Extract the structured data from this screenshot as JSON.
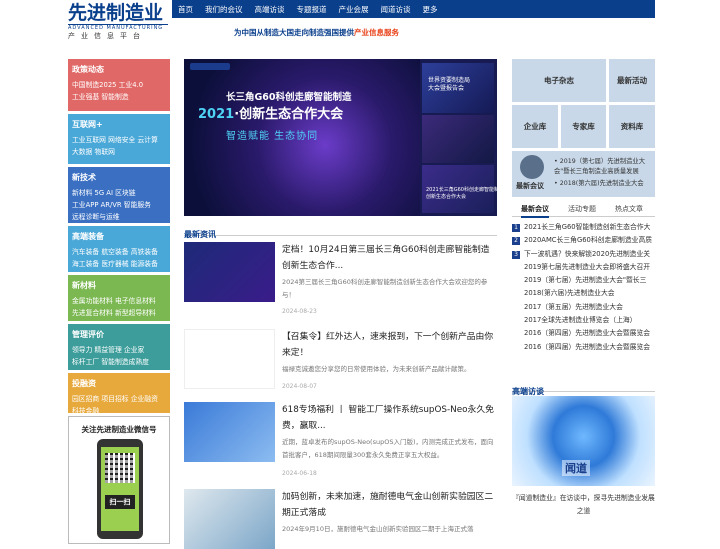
{
  "logo": {
    "name": "先进制造业",
    "en": "ADVANCED MANUFACTURING",
    "sub": "产业信息平台"
  },
  "nav": [
    "首页",
    "我们的会议",
    "高端访谈",
    "专题报道",
    "产业会展",
    "闻道访谈",
    "更多"
  ],
  "slogan": {
    "text": "为中国从制造大国走向制造强国提供",
    "hl": "产业信息服务"
  },
  "categories": [
    {
      "title": "政策动态",
      "lines": [
        "中国制造2025  工业4.0",
        "工业强基  智能制造"
      ]
    },
    {
      "title": "互联网+",
      "lines": [
        "工业互联网  网络安全  云计算",
        "大数据  物联网"
      ]
    },
    {
      "title": "新技术",
      "lines": [
        "新材料  5G  AI  区块链",
        "工业APP  AR/VR  智能服务",
        "远程诊断与运维"
      ]
    },
    {
      "title": "高端装备",
      "lines": [
        "汽车装备  航空装备  高铁装备",
        "海工装备  医疗器械  能源装备"
      ]
    },
    {
      "title": "新材料",
      "lines": [
        "金属功能材料  电子信息材料",
        "先进复合材料  新型超导材料"
      ]
    },
    {
      "title": "管理评价",
      "lines": [
        "领导力  精益管理  企业家",
        "标杆工厂  智能制造成熟度"
      ]
    },
    {
      "title": "投融资",
      "lines": [
        "园区招商  项目招标  企业融资",
        "科技金融"
      ]
    }
  ],
  "wechat": {
    "title": "关注先进制造业微信号",
    "scan": "扫一扫"
  },
  "banner": {
    "line1": "长三角G60科创走廊智能制造",
    "year": "2021",
    "line2": "·创新生态合作大会",
    "line3": "智造赋能  生态协同",
    "side1": "世界资要制造局\n大会暨报告会",
    "side3": "2021长三角G60科创走廊智能制造\n创新生态合作大会"
  },
  "latest_title": "最新资讯",
  "news": [
    {
      "title": "定档！10月24日第三届长三角G60科创走廊智能制造创新生态合作...",
      "desc": "2024第三届长三角G60科创走廊智能制造创新生态合作大会欢迎您的参与！",
      "date": "2024-08-23"
    },
    {
      "title": "【召集令】红外达人，速来报到，下一个创新产品由你来定！",
      "desc": "福禄克诚邀您分享您的日常使用体验，为未来创新产品献计献策。",
      "date": "2024-08-07"
    },
    {
      "title": "618专场福利 丨 智能工厂操作系统supOS-Neo永久免费，赢取...",
      "desc": "近期，蓝卓发布的supOS-Neo(supOS入门版)，内测完成正式发布，面向首批客户，618期间限量300套永久免费正享五大权益。",
      "date": "2024-06-18"
    },
    {
      "title": "加码创新，未来加速，施耐德电气金山创新实验园区二期正式落成",
      "desc": "2024年9月10日，施耐德电气金山创新实验园区二期于上海正式落",
      "date": ""
    }
  ],
  "tiles": {
    "mag": "电子杂志",
    "act": "最新活动",
    "ent": "企业库",
    "exp": "专家库",
    "res": "资料库",
    "meet": "最新会议"
  },
  "meet_lines": [
    "• 2019（第七届）先进制造业大",
    "   会\"暨长三角制造业高质量发展",
    "• 2018(第六届)先进制造业大会"
  ],
  "tabs": [
    "最新会议",
    "活动专题",
    "热点文章"
  ],
  "list": [
    {
      "n": "1",
      "t": "2021长三角G60智能制造创新生态合作大"
    },
    {
      "n": "2",
      "t": "2020AMC长三角G60科创走廊制造业高质"
    },
    {
      "n": "3",
      "t": "下一波机遇？快来解锁2020先进制造业关"
    },
    {
      "n": "",
      "t": "2019第七届先进制造业大会即将盛大召开"
    },
    {
      "n": "",
      "t": "2019（第七届）先进制造业大会\"暨长三"
    },
    {
      "n": "",
      "t": "2018(第六届)先进制造业大会"
    },
    {
      "n": "",
      "t": "2017（第五届）先进制造业大会"
    },
    {
      "n": "",
      "t": "2017全球先进制造业博览会（上海）"
    },
    {
      "n": "",
      "t": "2016（第四届）先进制造业大会暨展览会"
    },
    {
      "n": "",
      "t": "2016（第四届）先进制造业大会暨展览会"
    }
  ],
  "interview": {
    "title": "高端访谈",
    "logo": "闻道",
    "caption": "『闻道制造业』在访谈中，探寻先进制造业发展之道"
  }
}
